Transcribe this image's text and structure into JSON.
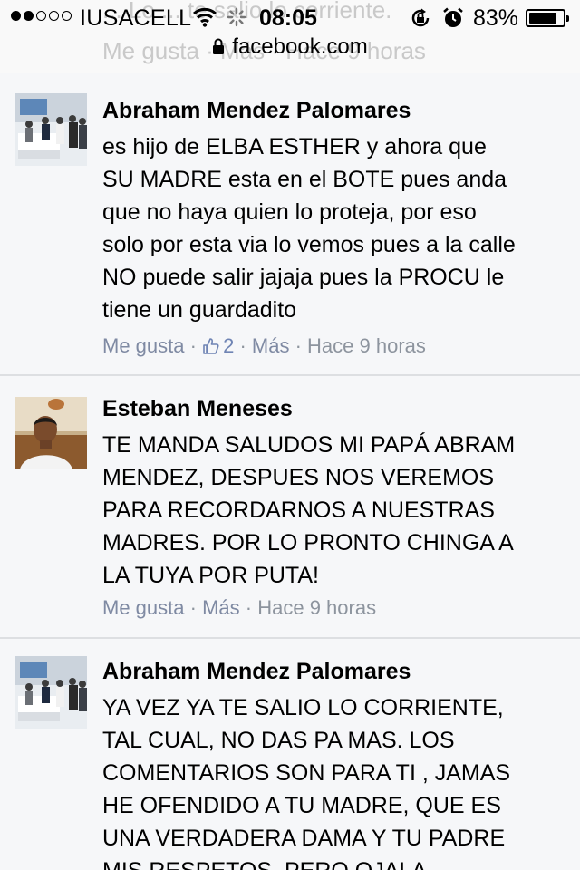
{
  "status_bar": {
    "carrier": "IUSACELL",
    "time": "08:05",
    "battery": "83%",
    "battery_level": 0.83
  },
  "url_bar": {
    "url": "facebook.com"
  },
  "ghost_above": {
    "line1": "... Lo ... te salio lo corriente.",
    "line2": "Me gusta · Más · Hace 9 horas"
  },
  "comments": [
    {
      "author": "Abraham Mendez Palomares",
      "lines": [
        "es hijo de ELBA ESTHER y ahora que",
        "SU MADRE esta en el BOTE pues anda",
        "que no haya quien lo proteja, por eso",
        "solo por esta via lo vemos pues a la calle",
        "NO puede salir jajaja pues la PROCU le",
        "tiene un guardadito"
      ],
      "like_label": "Me gusta",
      "like_count": "2",
      "more_label": "Más",
      "time_ago": "Hace 9 horas",
      "avatar_icon": "group-photo"
    },
    {
      "author": "Esteban Meneses",
      "lines": [
        "TE MANDA SALUDOS MI PAPÁ ABRAM",
        "MENDEZ, DESPUES NOS VEREMOS",
        "PARA RECORDARNOS A NUESTRAS",
        "MADRES. POR LO PRONTO CHINGA A",
        "LA TUYA POR PUTA!"
      ],
      "like_label": "Me gusta",
      "more_label": "Más",
      "time_ago": "Hace 9 horas",
      "avatar_icon": "man-portrait"
    },
    {
      "author": "Abraham Mendez Palomares",
      "lines": [
        "YA VEZ YA TE SALIO LO CORRIENTE,",
        "TAL CUAL, NO DAS PA MAS. LOS",
        "COMENTARIOS SON PARA TI , JAMAS",
        "HE OFENDIDO A TU MADRE, QUE ES",
        "UNA VERDADERA DAMA Y TU PADRE",
        "MIS RESPETOS, PERO OJALA"
      ],
      "avatar_icon": "group-photo"
    }
  ],
  "colors": {
    "background": "#f6f7f9",
    "meta_text": "#8d949e",
    "like_blue": "#6f84b4"
  }
}
